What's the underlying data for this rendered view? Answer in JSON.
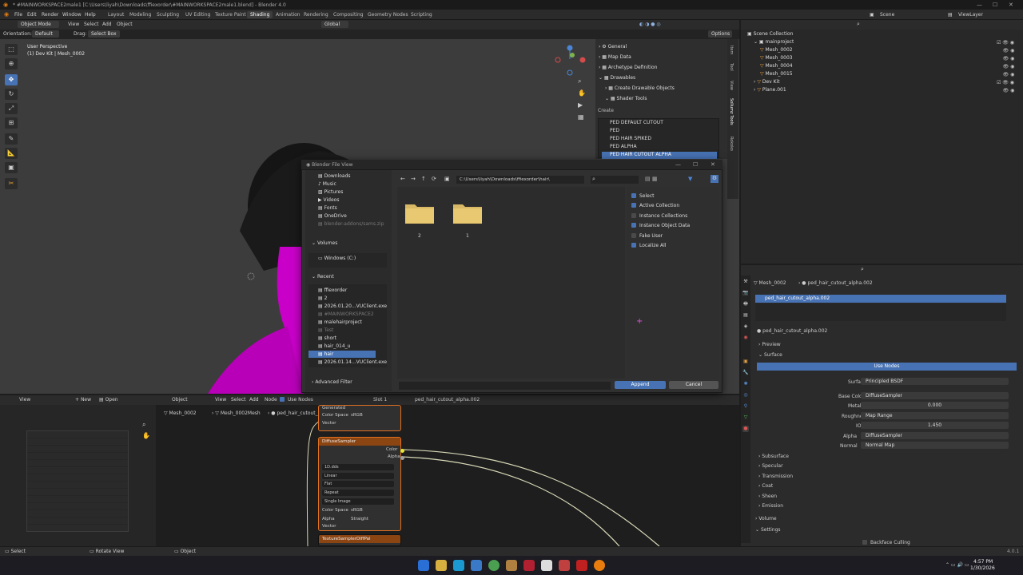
{
  "titlebar": {
    "title": "* #MAINWORKSPACE2male1 [C:\\Users\\liyah\\Downloads\\ffiexorder\\#MAINWORKSPACE2male1.blend] - Blender 4.0"
  },
  "menu": {
    "items": [
      "File",
      "Edit",
      "Render",
      "Window",
      "Help"
    ]
  },
  "workspaces": [
    "Layout",
    "Modeling",
    "Sculpting",
    "UV Editing",
    "Texture Paint",
    "Shading",
    "Animation",
    "Rendering",
    "Compositing",
    "Geometry Nodes",
    "Scripting"
  ],
  "active_workspace": "Shading",
  "scene": {
    "scene_label": "Scene",
    "viewlayer_label": "ViewLayer"
  },
  "viewport": {
    "mode": "Object Mode",
    "menus": [
      "View",
      "Select",
      "Add",
      "Object"
    ],
    "orientation_label": "Orientation:",
    "orientation_value": "Default",
    "drag_label": "Drag:",
    "drag_value": "Select Box",
    "transform": "Global",
    "options": "Options",
    "info_line1": "User Perspective",
    "info_line2": "(1) Dev Kit | Mesh_0002"
  },
  "npanel": {
    "items": [
      "General",
      "Map Data",
      "Archetype Definition",
      "Drawables",
      "Create Drawable Objects",
      "Shader Tools"
    ],
    "create_label": "Create",
    "shaders": [
      "PED DEFAULT CUTOUT",
      "PED",
      "PED HAIR SPIKED",
      "PED ALPHA",
      "PED HAIR CUTOUT ALPHA"
    ],
    "selected_shader": "PED HAIR CUTOUT ALPHA",
    "tabs": [
      "Item",
      "Tool",
      "View",
      "Sollumz Tools",
      "Rokoko"
    ]
  },
  "outliner": {
    "rows": [
      {
        "label": "Scene Collection",
        "indent": 0
      },
      {
        "label": "mainproject",
        "indent": 1
      },
      {
        "label": "Mesh_0002",
        "indent": 2
      },
      {
        "label": "Mesh_0003",
        "indent": 2
      },
      {
        "label": "Mesh_0004",
        "indent": 2
      },
      {
        "label": "Mesh_0015",
        "indent": 2
      },
      {
        "label": "Dev Kit",
        "indent": 1
      },
      {
        "label": "Plane.001",
        "indent": 1
      }
    ]
  },
  "properties": {
    "breadcrumb_mesh": "Mesh_0002",
    "breadcrumb_mat": "ped_hair_cutout_alpha.002",
    "slot_name": "ped_hair_cutout_alpha.002",
    "material_name": "ped_hair_cutout_alpha.002",
    "preview": "Preview",
    "surface": "Surface",
    "use_nodes": "Use Nodes",
    "fields": [
      {
        "label": "Surface",
        "value": "Principled BSDF"
      },
      {
        "label": "Base Color",
        "value": "DiffuseSampler"
      },
      {
        "label": "Metallic",
        "value": "0.000"
      },
      {
        "label": "Roughness",
        "value": "Map Range"
      },
      {
        "label": "IOR",
        "value": "1.450"
      },
      {
        "label": "Alpha",
        "value": "DiffuseSampler"
      },
      {
        "label": "Normal",
        "value": "Normal Map"
      }
    ],
    "sections": [
      "Subsurface",
      "Specular",
      "Transmission",
      "Coat",
      "Sheen",
      "Emission"
    ],
    "volume": "Volume",
    "settings": "Settings",
    "backface": "Backface Culling"
  },
  "dialog": {
    "title": "Blender File View",
    "path": "C:\\Users\\liyah\\Downloads\\ffiexorder\\hair\\",
    "places": [
      "Downloads",
      "Music",
      "Pictures",
      "Videos",
      "Fonts",
      "OneDrive",
      "blender-addons/sams.zip"
    ],
    "volumes_label": "Volumes",
    "volumes": [
      "Windows (C:)"
    ],
    "recent_label": "Recent",
    "recent": [
      "ffiexorder",
      "2",
      "2026.01.20...VUClient.exe",
      "#MAINWORKSPACE2",
      "malehairproject",
      "Test",
      "short",
      "hair_014_u",
      "hair",
      "2026.01.14...VUClient.exe"
    ],
    "recent_selected": "hair",
    "advanced_filter": "Advanced Filter",
    "folders": [
      "2",
      "1"
    ],
    "options": [
      {
        "label": "Select",
        "on": true
      },
      {
        "label": "Active Collection",
        "on": true
      },
      {
        "label": "Instance Collections",
        "on": false
      },
      {
        "label": "Instance Object Data",
        "on": true
      },
      {
        "label": "Fake User",
        "on": false
      },
      {
        "label": "Localize All",
        "on": true
      }
    ],
    "append": "Append",
    "cancel": "Cancel"
  },
  "node_editor": {
    "view": "View",
    "new": "New",
    "open": "Open",
    "menus": [
      "View",
      "Select",
      "Add",
      "Node"
    ],
    "object": "Object",
    "use_nodes": "Use Nodes",
    "slot": "Slot 1",
    "material": "ped_hair_cutout_alpha.002",
    "breadcrumb": [
      "Mesh_0002",
      "Mesh_0002Mesh",
      "ped_hair_cutout_alpha.002"
    ],
    "node_top": {
      "rows": [
        "Generated",
        "Color Space",
        "Vector"
      ],
      "cs_value": "sRGB"
    },
    "node_main": {
      "title": "DiffuseSampler",
      "out_color": "Color",
      "out_alpha": "Alpha",
      "image": "1D.dds",
      "selects": [
        "Linear",
        "Flat",
        "Repeat",
        "Single Image"
      ],
      "color_space_label": "Color Space",
      "color_space": "sRGB",
      "alpha_label": "Alpha",
      "alpha_value": "Straight",
      "vector": "Vector"
    },
    "node_bottom": {
      "title": "TextureSamplerDiffPal",
      "out_color": "Color"
    }
  },
  "status": {
    "select": "Select",
    "rotate": "Rotate View",
    "object": "Object",
    "version": "4.0.1"
  },
  "taskbar": {
    "time": "4:57 PM",
    "date": "1/30/2026"
  }
}
